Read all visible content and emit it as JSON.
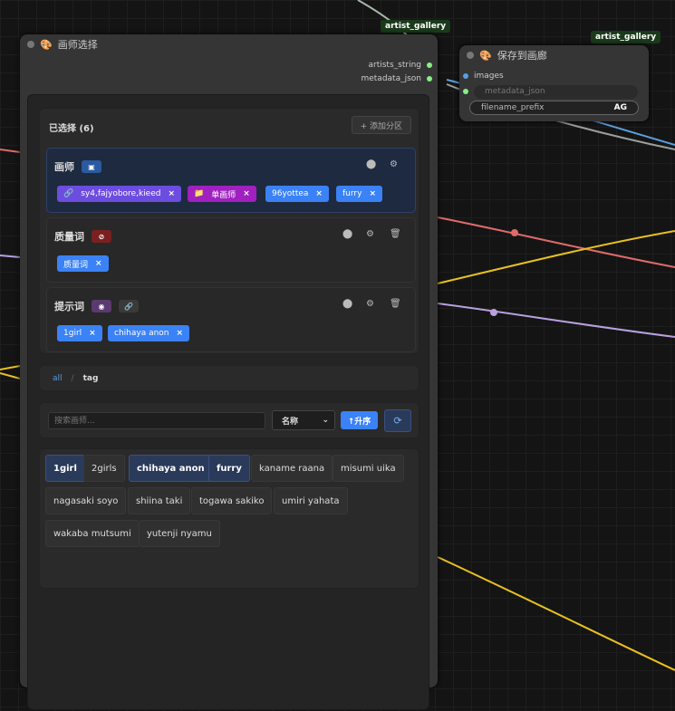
{
  "labels": {
    "top": "artist_gallery",
    "right": "artist_gallery"
  },
  "node_main": {
    "title": "画师选择",
    "outputs": [
      "artists_string",
      "metadata_json"
    ]
  },
  "node_save": {
    "title": "保存到画廊",
    "input_images": "images",
    "input_metadata": "metadata_json",
    "filename_label": "filename_prefix",
    "filename_value": "AG"
  },
  "selected": {
    "header": "已选择 (6)",
    "add_partition": "+ 添加分区",
    "groups": [
      {
        "name": "画师",
        "chips": [
          "sy4,fajyobore,kieed",
          "单画师",
          "96yottea",
          "furry"
        ]
      },
      {
        "name": "质量词",
        "chips": [
          "质量词"
        ]
      },
      {
        "name": "提示词",
        "chips": [
          "1girl",
          "chihaya anon"
        ]
      }
    ]
  },
  "breadcrumb": {
    "root": "all",
    "sep": "/",
    "current": "tag"
  },
  "search": {
    "placeholder": "搜索画师...",
    "sort_value": "名称",
    "order_label": "↑升序"
  },
  "tags": [
    {
      "label": "1girl",
      "selected": true
    },
    {
      "label": "2girls",
      "selected": false
    },
    {
      "label": "chihaya anon",
      "selected": true
    },
    {
      "label": "furry",
      "selected": true
    },
    {
      "label": "kaname raana",
      "selected": false
    },
    {
      "label": "misumi uika",
      "selected": false
    },
    {
      "label": "nagasaki soyo",
      "selected": false
    },
    {
      "label": "shiina taki",
      "selected": false
    },
    {
      "label": "togawa sakiko",
      "selected": false
    },
    {
      "label": "umiri yahata",
      "selected": false
    },
    {
      "label": "wakaba mutsumi",
      "selected": false
    },
    {
      "label": "yutenji nyamu",
      "selected": false
    }
  ],
  "colors": {
    "accent": "#3b82f6",
    "purple_chip": "#6d4de0",
    "magenta_chip": "#a020c0",
    "red_wire": "#e06a6a",
    "yellow_wire": "#e8c020",
    "lilac_wire": "#b9a0e0"
  },
  "icons": {
    "palette": "palette-icon",
    "gear": "gear-icon",
    "trash": "trash-icon",
    "link": "link-icon",
    "folder": "folder-icon",
    "circle": "circle-icon",
    "refresh": "refresh-icon"
  }
}
